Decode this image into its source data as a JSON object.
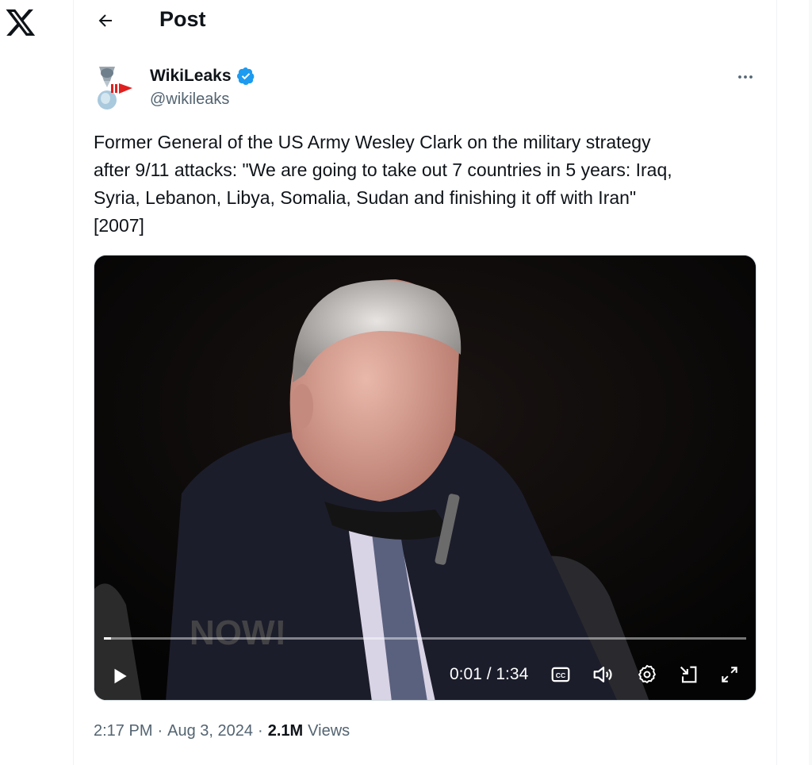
{
  "nav": {
    "logo_icon": "x-logo-icon"
  },
  "header": {
    "back_icon": "arrow-left-icon",
    "title": "Post"
  },
  "author": {
    "name": "WikiLeaks",
    "handle": "@wikileaks",
    "verified_icon": "verified-badge-icon",
    "verified_color": "#1d9bf0"
  },
  "post": {
    "text": "Former General of the US Army Wesley Clark on the military strategy\nafter 9/11 attacks: \"We are going to take out 7 countries in 5 years: Iraq,\nSyria, Lebanon, Libya, Somalia, Sudan and finishing it off with Iran\"\n[2007]"
  },
  "video": {
    "time": "0:01 / 1:34",
    "progress_fraction": 0.011,
    "controls": [
      "play-icon",
      "closed-captions-icon",
      "volume-icon",
      "settings-gear-icon",
      "picture-in-picture-icon",
      "fullscreen-icon"
    ]
  },
  "meta": {
    "time": "2:17 PM",
    "sep1": "·",
    "date": "Aug 3, 2024",
    "sep2": "·",
    "views_count": "2.1M",
    "views_label": "Views"
  },
  "colors": {
    "text": "#0f1419",
    "muted": "#536471",
    "accent": "#1d9bf0"
  }
}
